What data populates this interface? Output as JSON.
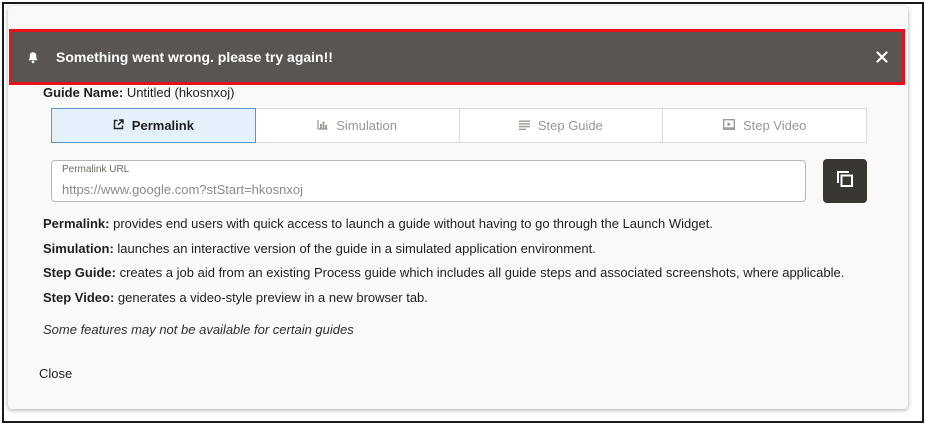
{
  "banner": {
    "message": "Something went wrong. please try again!!",
    "icon": "bell-icon",
    "close_icon": "close-icon",
    "background_color": "#5a5550",
    "highlight_border_color": "#e8101a"
  },
  "guide": {
    "label": "Guide Name:",
    "value": "Untitled (hkosnxoj)"
  },
  "tabs": [
    {
      "label": "Permalink",
      "icon": "external-link-icon",
      "active": true
    },
    {
      "label": "Simulation",
      "icon": "bar-chart-icon",
      "active": false
    },
    {
      "label": "Step Guide",
      "icon": "list-lines-icon",
      "active": false
    },
    {
      "label": "Step Video",
      "icon": "video-player-icon",
      "active": false
    }
  ],
  "permalink": {
    "field_label": "Permalink URL",
    "value": "https://www.google.com?stStart=hkosnxoj",
    "copy_icon": "copy-icon"
  },
  "descriptions": [
    {
      "term": "Permalink:",
      "text": " provides end users with quick access to launch a guide without having to go through the Launch Widget."
    },
    {
      "term": "Simulation:",
      "text": " launches an interactive version of the guide in a simulated application environment."
    },
    {
      "term": "Step Guide:",
      "text": " creates a job aid from an existing Process guide which includes all guide steps and associated screenshots, where applicable."
    },
    {
      "term": "Step Video:",
      "text": " generates a video-style preview in a new browser tab."
    }
  ],
  "note": "Some features may not be available for certain guides",
  "close_label": "Close",
  "colors": {
    "active_tab_bg": "#e4f1fa",
    "active_tab_border": "#5b97c4",
    "copy_button_bg": "#3a3632"
  }
}
